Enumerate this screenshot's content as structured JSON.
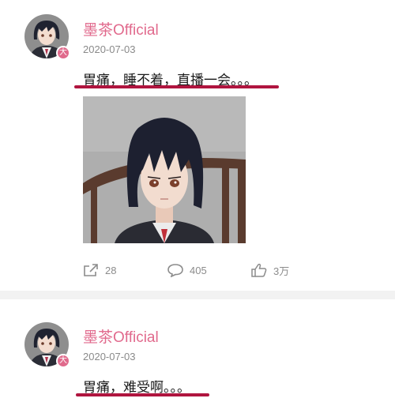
{
  "posts": [
    {
      "username": "墨茶Official",
      "badge": "大",
      "date": "2020-07-03",
      "text": "胃痛，睡不着，直播一会。。。",
      "actions": {
        "share_count": "28",
        "comment_count": "405",
        "like_count": "3万"
      }
    },
    {
      "username": "墨茶Official",
      "badge": "大",
      "date": "2020-07-03",
      "text": "胃痛，难受啊。。。"
    }
  ],
  "colors": {
    "username": "#e16a8d",
    "underline": "#b0153f",
    "badge": "#e06a8c"
  },
  "icons": [
    "share-icon",
    "comment-icon",
    "like-icon"
  ]
}
